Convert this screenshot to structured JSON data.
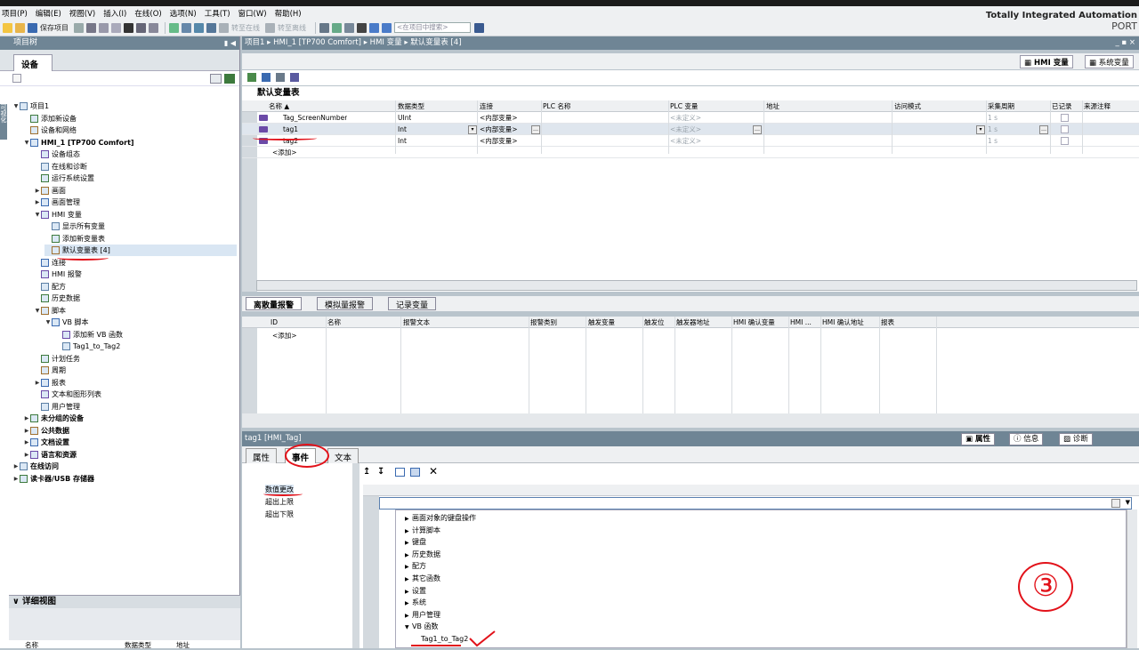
{
  "menu": [
    "项目(P)",
    "编辑(E)",
    "视图(V)",
    "插入(I)",
    "在线(O)",
    "选项(N)",
    "工具(T)",
    "窗口(W)",
    "帮助(H)"
  ],
  "toolbar": {
    "save_label": "保存项目",
    "go_online": "转至在线",
    "go_offline": "转至离线",
    "search_placeholder": "<在项目中搜索>"
  },
  "brand": {
    "line1": "Totally Integrated Automation",
    "line2": "PORT"
  },
  "left": {
    "header": "项目树",
    "vertical_tab": "可视化",
    "tab": "设备",
    "tree": [
      {
        "label": "项目1",
        "level": 0,
        "arrow": "▼"
      },
      {
        "label": "添加新设备",
        "level": 1,
        "arrow": ""
      },
      {
        "label": "设备和网络",
        "level": 1,
        "arrow": ""
      },
      {
        "label": "HMI_1 [TP700 Comfort]",
        "level": 1,
        "arrow": "▼"
      },
      {
        "label": "设备组态",
        "level": 2,
        "arrow": ""
      },
      {
        "label": "在线和诊断",
        "level": 2,
        "arrow": ""
      },
      {
        "label": "运行系统设置",
        "level": 2,
        "arrow": ""
      },
      {
        "label": "画面",
        "level": 2,
        "arrow": "▶"
      },
      {
        "label": "画面管理",
        "level": 2,
        "arrow": "▶"
      },
      {
        "label": "HMI 变量",
        "level": 2,
        "arrow": "▼"
      },
      {
        "label": "显示所有变量",
        "level": 3,
        "arrow": ""
      },
      {
        "label": "添加新变量表",
        "level": 3,
        "arrow": ""
      },
      {
        "label": "默认变量表 [4]",
        "level": 3,
        "arrow": "",
        "selected": true
      },
      {
        "label": "连接",
        "level": 2,
        "arrow": ""
      },
      {
        "label": "HMI 报警",
        "level": 2,
        "arrow": ""
      },
      {
        "label": "配方",
        "level": 2,
        "arrow": ""
      },
      {
        "label": "历史数据",
        "level": 2,
        "arrow": ""
      },
      {
        "label": "脚本",
        "level": 2,
        "arrow": "▼"
      },
      {
        "label": "VB 脚本",
        "level": 3,
        "arrow": "▼"
      },
      {
        "label": "添加新 VB 函数",
        "level": 4,
        "arrow": ""
      },
      {
        "label": "Tag1_to_Tag2",
        "level": 4,
        "arrow": ""
      },
      {
        "label": "计划任务",
        "level": 2,
        "arrow": ""
      },
      {
        "label": "周期",
        "level": 2,
        "arrow": ""
      },
      {
        "label": "报表",
        "level": 2,
        "arrow": "▶"
      },
      {
        "label": "文本和图形列表",
        "level": 2,
        "arrow": ""
      },
      {
        "label": "用户管理",
        "level": 2,
        "arrow": ""
      },
      {
        "label": "未分组的设备",
        "level": 1,
        "arrow": "▶"
      },
      {
        "label": "公共数据",
        "level": 1,
        "arrow": "▶"
      },
      {
        "label": "文档设置",
        "level": 1,
        "arrow": "▶"
      },
      {
        "label": "语言和资源",
        "level": 1,
        "arrow": "▶"
      },
      {
        "label": "在线访问",
        "level": 0,
        "arrow": "▶"
      },
      {
        "label": "读卡器/USB 存储器",
        "level": 0,
        "arrow": "▶"
      }
    ],
    "detail_header": "详细视图",
    "detail_cols": [
      "名称",
      "数据类型",
      "地址"
    ]
  },
  "breadcrumb": {
    "items": [
      "项目1",
      "HMI_1 [TP700 Comfort]",
      "HMI 变量",
      "默认变量表 [4]"
    ]
  },
  "right_tabs": {
    "hmi_tags": "HMI 变量",
    "system_tags": "系统变量"
  },
  "table": {
    "title": "默认变量表",
    "columns": [
      "名称 ▲",
      "数据类型",
      "连接",
      "PLC 名称",
      "PLC 变量",
      "地址",
      "访问模式",
      "采集周期",
      "已记录",
      "来源注释"
    ],
    "rows": [
      {
        "name": "Tag_ScreenNumber",
        "type": "UInt",
        "conn": "<内部变量>",
        "plc_tag": "<未定义>",
        "cycle": "1 s"
      },
      {
        "name": "tag1",
        "type": "Int",
        "conn": "<内部变量>",
        "plc_tag": "<未定义>",
        "cycle": "1 s"
      },
      {
        "name": "tag2",
        "type": "Int",
        "conn": "<内部变量>",
        "plc_tag": "<未定义>",
        "cycle": "1 s"
      }
    ],
    "add_row": "<添加>"
  },
  "alarms": {
    "tabs": [
      "离散量报警",
      "模拟量报警",
      "记录变量"
    ],
    "columns": [
      "ID",
      "名称",
      "报警文本",
      "报警类别",
      "触发变量",
      "触发位",
      "触发器地址",
      "HMI 确认变量",
      "HMI ...",
      "HMI 确认地址",
      "报表"
    ],
    "add_row": "<添加>"
  },
  "inspector": {
    "title": "tag1 [HMI_Tag]",
    "right_tabs": [
      "属性",
      "信息",
      "诊断"
    ],
    "tabs": [
      "属性",
      "事件",
      "文本"
    ],
    "events": [
      "数值更改",
      "超出上限",
      "超出下限"
    ],
    "function_tree": [
      {
        "label": "画面对象的键盘操作",
        "arrow": "▶"
      },
      {
        "label": "计算脚本",
        "arrow": "▶"
      },
      {
        "label": "键盘",
        "arrow": "▶"
      },
      {
        "label": "历史数据",
        "arrow": "▶"
      },
      {
        "label": "配方",
        "arrow": "▶"
      },
      {
        "label": "其它函数",
        "arrow": "▶"
      },
      {
        "label": "设置",
        "arrow": "▶"
      },
      {
        "label": "系统",
        "arrow": "▶"
      },
      {
        "label": "用户管理",
        "arrow": "▶"
      },
      {
        "label": "VB 函数",
        "arrow": "▼"
      },
      {
        "label": "Tag1_to_Tag2",
        "arrow": "",
        "child": true
      }
    ]
  },
  "annotation": {
    "step": "③"
  },
  "colors": {
    "panel_header": "#6f8595",
    "annotation_red": "#e2121a",
    "tag_icon": "#6b4aa7"
  }
}
